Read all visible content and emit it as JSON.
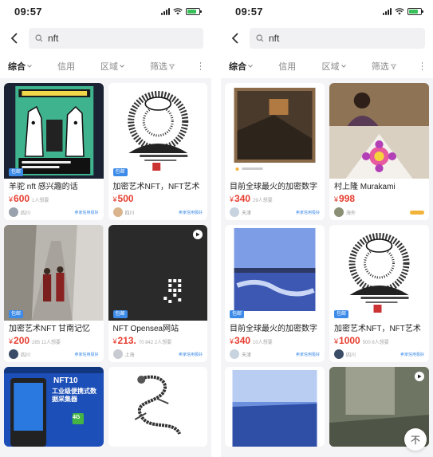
{
  "status_bar": {
    "time": "09:57"
  },
  "search": {
    "query": "nft"
  },
  "filters": [
    "综合",
    "信用",
    "区域",
    "筛选"
  ],
  "left": {
    "cards": [
      {
        "title": "羊驼 nft 感兴趣的话",
        "price": "600",
        "extra": "1人想要",
        "seller": "四川",
        "badge": "包邮",
        "chip": "卖家信用极好"
      },
      {
        "title": "加密艺术NFT，NFT艺术",
        "price": "500",
        "extra": "",
        "seller": "四川",
        "badge": "包邮",
        "chip": "卖家信用极好"
      },
      {
        "title": "加密艺术NFT 甘南记忆",
        "price": "200",
        "extra": "285 11人想要",
        "seller": "四川",
        "badge": "包邮",
        "chip": "卖家信用极好"
      },
      {
        "title": "NFT Opensea网站",
        "price": "213.",
        "extra": "70 842 2人想要",
        "seller": "上海",
        "badge": "包邮",
        "chip": "卖家信用极好"
      },
      {
        "title": "",
        "price": "",
        "extra": "",
        "seller": "",
        "badge": "",
        "chip": "",
        "poster_top": "NFT10",
        "poster_sub": "工业级便携式数据采集器",
        "poster_tag": "4G"
      },
      {
        "title": "",
        "price": "",
        "extra": "",
        "seller": "",
        "badge": "",
        "chip": ""
      }
    ]
  },
  "right": {
    "cards": [
      {
        "title": "目前全球最火的加密数字",
        "price": "340",
        "extra": "29人想要",
        "seller": "天津",
        "badge": "包邮",
        "chip": "卖家信用极好"
      },
      {
        "title": "村上隆 Murakami",
        "price": "998",
        "extra": "",
        "seller": "海外",
        "badge": "",
        "chip": ""
      },
      {
        "title": "目前全球最火的加密数字",
        "price": "340",
        "extra": "10人想要",
        "seller": "天津",
        "badge": "包邮",
        "chip": "卖家信用极好"
      },
      {
        "title": "加密艺术NFT，NFT艺术",
        "price": "1000",
        "extra": "500 8人想要",
        "seller": "四川",
        "badge": "包邮",
        "chip": "卖家信用极好"
      },
      {
        "title": "",
        "price": "",
        "extra": "",
        "seller": "",
        "badge": "",
        "chip": ""
      },
      {
        "title": "",
        "price": "",
        "extra": "",
        "seller": "",
        "badge": "",
        "chip": ""
      }
    ],
    "float_button": "不"
  },
  "colors": {
    "price": "#e63c2e",
    "badge": "#3d8be8"
  }
}
